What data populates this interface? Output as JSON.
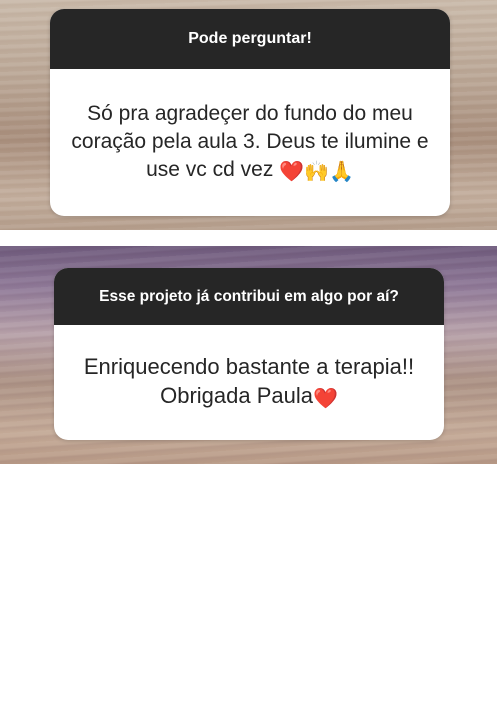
{
  "question_cards": [
    {
      "question": "Pode perguntar!",
      "answer": "Só pra agradeçer do fundo do meu coração pela aula 3. Deus te ilumine e use vc cd vez",
      "emojis": [
        "❤️",
        "🙌",
        "🙏"
      ]
    },
    {
      "question": "Esse projeto já contribui em algo por aí?",
      "answer": "Enriquecendo bastante a terapia!! Obrigada Paula",
      "emojis": [
        "❤️"
      ]
    }
  ]
}
